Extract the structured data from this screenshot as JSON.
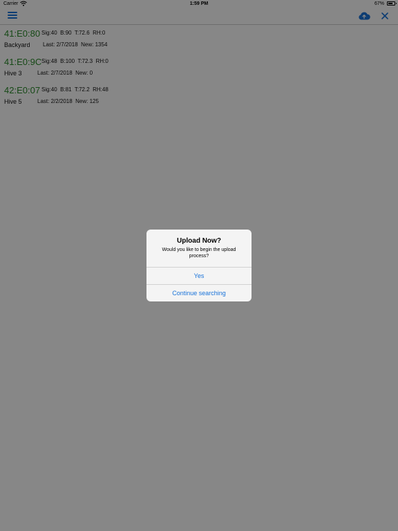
{
  "status_bar": {
    "carrier": "Carrier",
    "time": "1:59 PM",
    "battery": "67%"
  },
  "nav": {
    "menu_icon": "hamburger-menu-icon",
    "upload_icon": "cloud-upload-icon",
    "close_icon": "close-icon",
    "accent_color": "#1a73d9"
  },
  "devices": [
    {
      "id": "41:E0:80",
      "stats": "Sig:40  B:90  T:72.6  RH:0",
      "name": "Backyard",
      "meta": "Last: 2/7/2018  New: 1354"
    },
    {
      "id": "41:E0:9C",
      "stats": "Sig:48  B:100  T:72.3  RH:0",
      "name": "Hive 3",
      "meta": "Last: 2/7/2018  New: 0"
    },
    {
      "id": "42:E0:07",
      "stats": "Sig:40  B:81  T:72.2  RH:48",
      "name": "Hive 5",
      "meta": "Last: 2/2/2018  New: 125"
    }
  ],
  "device_id_color": "#2a8a2a",
  "alert": {
    "title": "Upload Now?",
    "message": "Would you like to begin the upload process?",
    "yes_label": "Yes",
    "continue_label": "Continue searching"
  }
}
